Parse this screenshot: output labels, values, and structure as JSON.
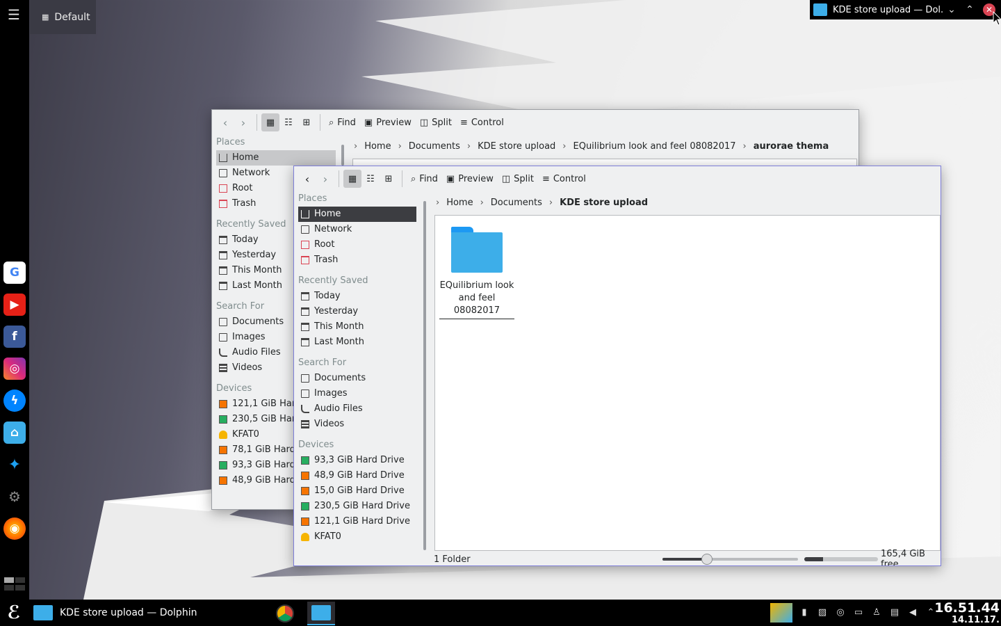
{
  "desktop": {
    "activity": "Default",
    "active_window_title": "KDE store upload — Dol..."
  },
  "dock": {
    "apps": [
      "google-chrome-icon",
      "youtube-icon",
      "facebook-icon",
      "instagram-icon",
      "messenger-icon",
      "home-folder-icon",
      "twitter-icon",
      "kde-icon",
      "firefox-icon"
    ]
  },
  "back_window": {
    "toolbar": {
      "find": "Find",
      "preview": "Preview",
      "split": "Split",
      "control": "Control"
    },
    "breadcrumb": [
      "Home",
      "Documents",
      "KDE store upload",
      "EQuilibrium look and feel 08082017"
    ],
    "breadcrumb_current": "aurorae thema",
    "places": {
      "header_places": "Places",
      "places": [
        "Home",
        "Network",
        "Root",
        "Trash"
      ],
      "header_recent": "Recently Saved",
      "recent": [
        "Today",
        "Yesterday",
        "This Month",
        "Last Month"
      ],
      "header_search": "Search For",
      "search": [
        "Documents",
        "Images",
        "Audio Files",
        "Videos"
      ],
      "header_devices": "Devices",
      "devices": [
        "121,1 GiB Hard",
        "230,5 GiB Hard",
        "KFAT0",
        "78,1 GiB Hard",
        "93,3 GiB Hard",
        "48,9 GiB Hard"
      ]
    }
  },
  "front_window": {
    "toolbar": {
      "find": "Find",
      "preview": "Preview",
      "split": "Split",
      "control": "Control"
    },
    "breadcrumb": [
      "Home",
      "Documents"
    ],
    "breadcrumb_current": "KDE store upload",
    "places": {
      "header_places": "Places",
      "places": [
        "Home",
        "Network",
        "Root",
        "Trash"
      ],
      "header_recent": "Recently Saved",
      "recent": [
        "Today",
        "Yesterday",
        "This Month",
        "Last Month"
      ],
      "header_search": "Search For",
      "search": [
        "Documents",
        "Images",
        "Audio Files",
        "Videos"
      ],
      "header_devices": "Devices",
      "devices": [
        "93,3 GiB Hard Drive",
        "48,9 GiB Hard Drive",
        "15,0 GiB Hard Drive",
        "230,5 GiB Hard Drive",
        "121,1 GiB Hard Drive",
        "KFAT0"
      ]
    },
    "folder_label_lines": [
      "EQuilibrium look",
      "and feel",
      "08082017"
    ],
    "status_count": "1 Folder",
    "free_space": "165,4 GiB free",
    "zoom_fraction": 0.33,
    "used_space_fraction": 0.25
  },
  "taskbar": {
    "task_label": "KDE store upload — Dolphin",
    "time": "16.51.44",
    "date": "14.11.17."
  },
  "colors": {
    "accent": "#3daee9",
    "close": "#da4453",
    "selection": "#3c3d41"
  }
}
